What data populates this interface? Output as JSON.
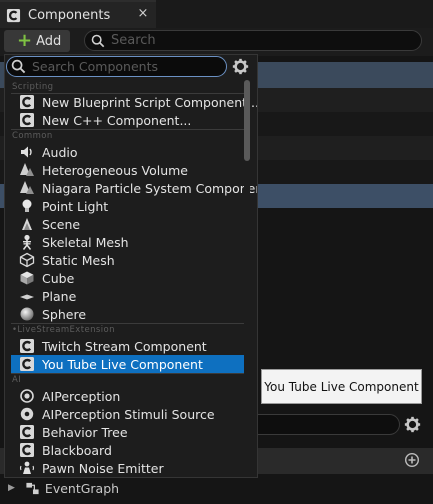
{
  "window": {
    "tab_title": "Components",
    "close_glyph": "×"
  },
  "toolbar": {
    "add_label": "Add",
    "add_glyph": "+",
    "search_placeholder": "Search"
  },
  "popup": {
    "search_placeholder": "Search Components",
    "categories": {
      "scripting": "Scripting",
      "common": "Common",
      "livestream": "•LiveStreamExtension",
      "ai": "AI"
    },
    "items": {
      "new_blueprint": "New Blueprint Script Component...",
      "new_cpp": "New C++ Component...",
      "audio": "Audio",
      "hetero_volume": "Heterogeneous Volume",
      "niagara": "Niagara Particle System Component",
      "point_light": "Point Light",
      "scene": "Scene",
      "skeletal_mesh": "Skeletal Mesh",
      "static_mesh": "Static Mesh",
      "cube": "Cube",
      "plane": "Plane",
      "sphere": "Sphere",
      "twitch": "Twitch Stream Component",
      "youtube": "You Tube Live Component",
      "ai_perception": "AIPerception",
      "ai_stimuli": "AIPerception Stimuli Source",
      "behavior_tree": "Behavior Tree",
      "blackboard": "Blackboard",
      "pawn_noise": "Pawn Noise Emitter"
    },
    "selected_item": "youtube"
  },
  "tooltip": {
    "text": "You Tube Live Component"
  },
  "bottom": {
    "event_graph": "EventGraph",
    "arrow_glyph": "▶"
  },
  "colors": {
    "accent_selected": "#0e70c0",
    "search_focus_border": "#6b91c4",
    "add_plus": "#7fc243",
    "highlight_row": "#3d4f66"
  },
  "icons": {
    "tab": "components-tab-icon",
    "search": "search-icon",
    "gear": "gear-icon",
    "add": "plus-circle-icon"
  }
}
